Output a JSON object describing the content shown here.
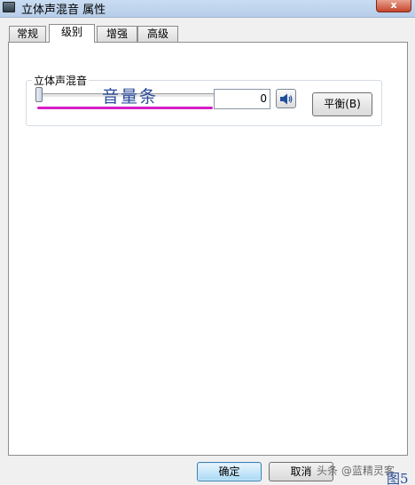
{
  "window": {
    "title": "立体声混音 属性",
    "close_label": "x"
  },
  "tabs": [
    {
      "label": "常规",
      "active": false
    },
    {
      "label": "级别",
      "active": true
    },
    {
      "label": "增强",
      "active": false
    },
    {
      "label": "高级",
      "active": false
    }
  ],
  "level_group": {
    "label": "立体声混音",
    "annotation": "音量条",
    "value": "0",
    "slider_level": 0,
    "balance_label": "平衡(B)"
  },
  "buttons": {
    "ok_label": "确定",
    "cancel_label": "取消"
  },
  "overlay": {
    "watermark": "头条 @蓝精灵客",
    "figure_label": "图5"
  },
  "colors": {
    "annotation_line": "#d81ec8",
    "annotation_text": "#2a4b9a",
    "ok_button": "#a7d9f5"
  }
}
